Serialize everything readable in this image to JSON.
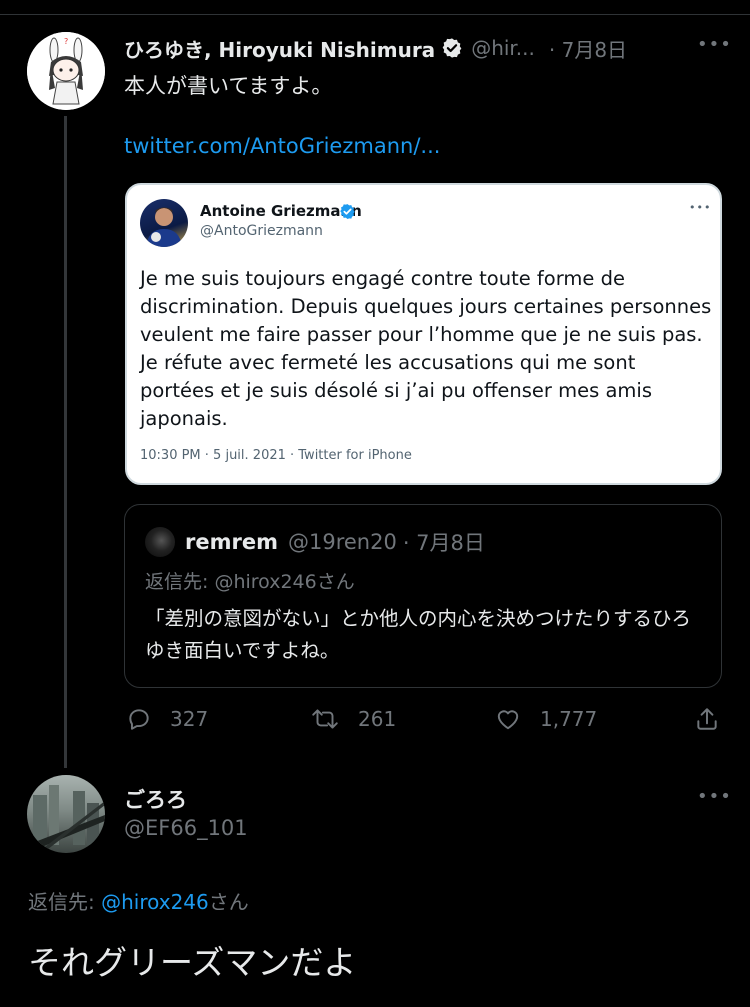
{
  "tweet": {
    "author_name": "ひろゆき, Hiroyuki Nishimura",
    "handle": "@hir...",
    "date": "· 7月8日",
    "text": "本人が書いてますよ。",
    "link": "twitter.com/AntoGriezmann/...",
    "more_icon": "more-horizontal-icon"
  },
  "quoted_image_tweet": {
    "author_name": "Antoine Griezmann",
    "handle": "@AntoGriezmann",
    "text": "Je me suis toujours engagé contre toute forme de discrimination. Depuis quelques jours certaines personnes veulent me faire passer pour l’homme que je ne suis pas. Je réfute avec fermeté les accusations qui me sont portées et je suis désolé si j’ai pu offenser mes amis japonais.",
    "meta": "10:30 PM · 5 juil. 2021 · Twitter for iPhone"
  },
  "quoted_tweet": {
    "author_name": "remrem",
    "handle": "@19ren20",
    "date": "· 7月8日",
    "reply_to": "返信先: @hirox246さん",
    "text": "「差別の意図がない」とか他人の内心を決めつけたりするひろゆき面白いですよね。"
  },
  "actions": {
    "replies": "327",
    "retweets": "261",
    "likes": "1,777"
  },
  "reply": {
    "author_name": "ごろろ",
    "handle": "@EF66_101",
    "reply_prefix": "返信先: ",
    "reply_handle": "@hirox246",
    "reply_suffix": "さん",
    "text": "それグリーズマンだよ"
  },
  "colors": {
    "background": "#000000",
    "accent": "#1d9bf0",
    "muted": "#71767b",
    "verified": "#1d9bf0"
  }
}
